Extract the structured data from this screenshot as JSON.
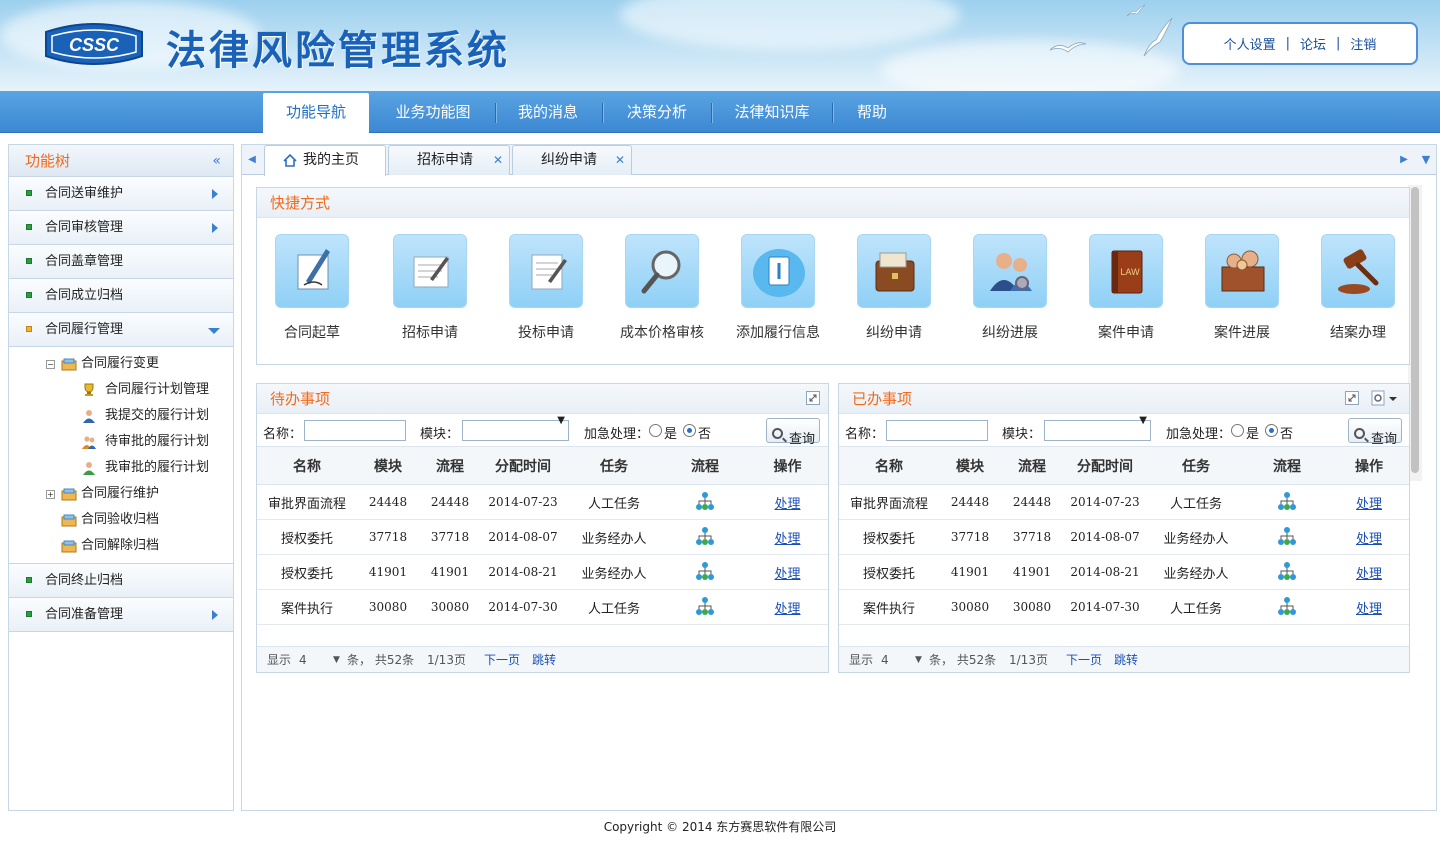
{
  "header": {
    "logo_text": "CSSC",
    "title": "法律风险管理系统",
    "user_links": [
      "个人设置",
      "论坛",
      "注销"
    ],
    "separator": "|"
  },
  "nav": {
    "items": [
      "功能导航",
      "业务功能图",
      "我的消息",
      "决策分析",
      "法律知识库",
      "帮助"
    ],
    "active_index": 0
  },
  "sidebar": {
    "title": "功能树",
    "collapse_icon": "«",
    "items_top": [
      "合同送审维护",
      "合同审核管理",
      "合同盖章管理",
      "合同成立归档",
      "合同履行管理"
    ],
    "tree": {
      "group1": "合同履行变更",
      "group1_children": [
        "合同履行计划管理",
        "我提交的履行计划",
        "待审批的履行计划",
        "我审批的履行计划"
      ],
      "group2": "合同履行维护",
      "item3": "合同验收归档",
      "item4": "合同解除归档"
    },
    "items_bottom": [
      "合同终止归档",
      "合同准备管理"
    ]
  },
  "tabs": [
    {
      "label": "我的主页",
      "icon": "home-icon",
      "closable": false
    },
    {
      "label": "招标申请",
      "closable": true
    },
    {
      "label": "纠纷申请",
      "closable": true
    }
  ],
  "shortcuts": {
    "title": "快捷方式",
    "items": [
      {
        "label": "合同起草",
        "icon": "pen-paper-icon"
      },
      {
        "label": "招标申请",
        "icon": "form-pen-icon"
      },
      {
        "label": "投标申请",
        "icon": "form-edit-icon"
      },
      {
        "label": "成本价格审核",
        "icon": "magnifier-icon"
      },
      {
        "label": "添加履行信息",
        "icon": "notebook-icon"
      },
      {
        "label": "纠纷申请",
        "icon": "briefcase-icon"
      },
      {
        "label": "纠纷进展",
        "icon": "people-gear-icon"
      },
      {
        "label": "案件申请",
        "icon": "law-book-icon"
      },
      {
        "label": "案件进展",
        "icon": "box-gears-icon"
      },
      {
        "label": "结案办理",
        "icon": "gavel-icon"
      }
    ]
  },
  "filter": {
    "name_label": "名称：",
    "module_label": "模块：",
    "urgent_label": "加急处理：",
    "yes": "是",
    "no": "否",
    "query": "查询"
  },
  "columns": [
    "名称",
    "模块",
    "流程",
    "分配时间",
    "任务",
    "流程",
    "操作"
  ],
  "pending": {
    "title": "待办事项",
    "rows": [
      {
        "name": "审批界面流程",
        "module": "24448",
        "flow": "24448",
        "time": "2014-07-23",
        "task": "人工任务",
        "action": "处理"
      },
      {
        "name": "授权委托",
        "module": "37718",
        "flow": "37718",
        "time": "2014-08-07",
        "task": "业务经办人",
        "action": "处理"
      },
      {
        "name": "授权委托",
        "module": "41901",
        "flow": "41901",
        "time": "2014-08-21",
        "task": "业务经办人",
        "action": "处理"
      },
      {
        "name": "案件执行",
        "module": "30080",
        "flow": "30080",
        "time": "2014-07-30",
        "task": "人工任务",
        "action": "处理"
      }
    ]
  },
  "done": {
    "title": "已办事项",
    "rows": [
      {
        "name": "审批界面流程",
        "module": "24448",
        "flow": "24448",
        "time": "2014-07-23",
        "task": "人工任务",
        "action": "处理"
      },
      {
        "name": "授权委托",
        "module": "37718",
        "flow": "37718",
        "time": "2014-08-07",
        "task": "业务经办人",
        "action": "处理"
      },
      {
        "name": "授权委托",
        "module": "41901",
        "flow": "41901",
        "time": "2014-08-21",
        "task": "业务经办人",
        "action": "处理"
      },
      {
        "name": "案件执行",
        "module": "30080",
        "flow": "30080",
        "time": "2014-07-30",
        "task": "人工任务",
        "action": "处理"
      }
    ]
  },
  "pager": {
    "show": "显示",
    "page_size": "4",
    "summary": "条， 共52条",
    "page_info": "1/13页",
    "next": "下一页",
    "jump": "跳转"
  },
  "footer": "Copyright © 2014 东方赛思软件有限公司",
  "colors": {
    "brand_blue": "#1a62b8",
    "nav_blue": "#3c88d2",
    "accent_orange": "#f26a1b",
    "link": "#1a4fb8"
  }
}
